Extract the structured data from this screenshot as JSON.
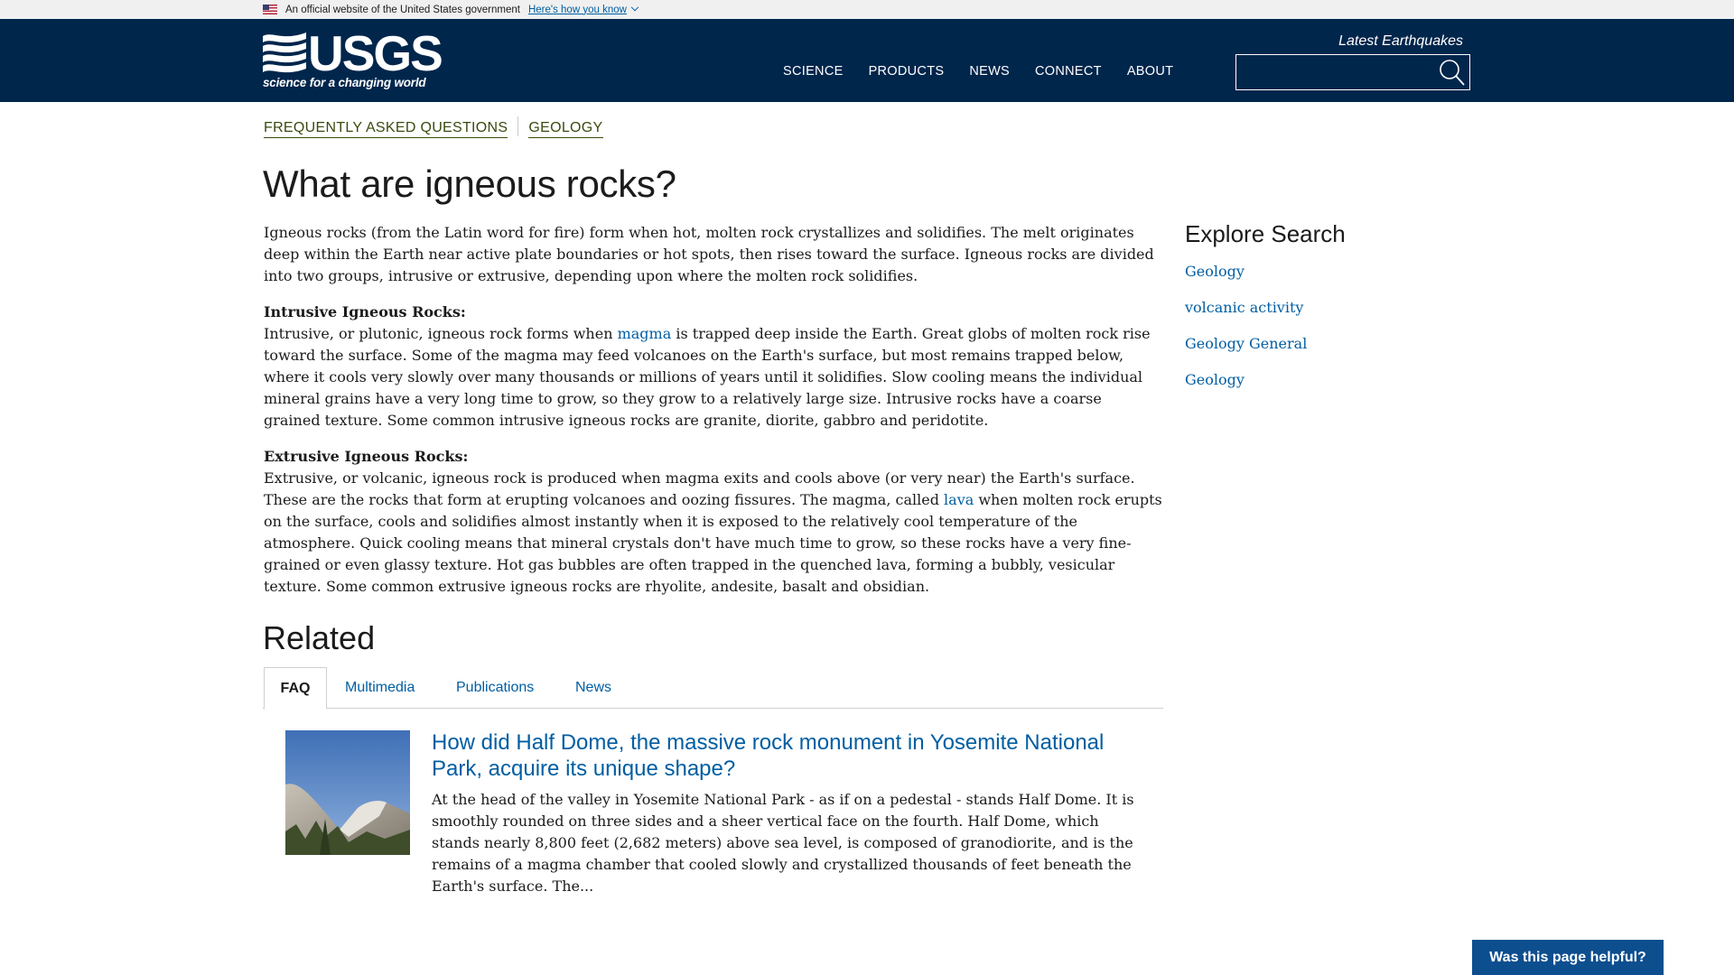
{
  "gov_banner": {
    "text": "An official website of the United States government",
    "link": "Here's how you know"
  },
  "header": {
    "logo_word": "USGS",
    "logo_tagline": "science for a changing world",
    "nav": [
      "SCIENCE",
      "PRODUCTS",
      "NEWS",
      "CONNECT",
      "ABOUT"
    ],
    "latest_earthquakes": "Latest Earthquakes",
    "search_value": ""
  },
  "breadcrumb": [
    "FREQUENTLY ASKED QUESTIONS",
    "GEOLOGY"
  ],
  "page_title": "What are igneous rocks?",
  "article": {
    "intro": "Igneous rocks (from the Latin word for fire) form when hot, molten rock crystallizes and solidifies. The melt originates deep within the Earth near active plate boundaries or hot spots, then rises toward the surface. Igneous rocks are divided into two groups, intrusive or extrusive, depending upon where the molten rock solidifies.",
    "intrusive_heading": "Intrusive Igneous Rocks:",
    "intrusive_pre": "Intrusive, or plutonic, igneous rock forms when ",
    "intrusive_link": "magma",
    "intrusive_post": " is trapped deep inside the Earth. Great globs of molten rock rise toward the surface. Some of the magma may feed volcanoes on the Earth's surface, but most remains trapped below, where it cools very slowly over many thousands or millions of years until it solidifies. Slow cooling means the individual mineral grains have a very long time to grow, so they grow to a relatively large size. Intrusive rocks have a coarse grained texture. Some common intrusive igneous rocks are granite, diorite, gabbro and peridotite.",
    "extrusive_heading": "Extrusive Igneous Rocks:",
    "extrusive_pre": "Extrusive, or volcanic, igneous rock is produced when magma exits and cools above (or very near) the Earth's surface. These are the rocks that form at erupting volcanoes and oozing fissures. The magma, called ",
    "extrusive_link": "lava",
    "extrusive_post": " when molten rock erupts on the surface, cools and solidifies almost instantly when it is exposed to the relatively cool temperature of the atmosphere. Quick cooling means that mineral crystals don't have much time to grow, so these rocks have a very fine-grained or even glassy texture. Hot gas bubbles are often trapped in the quenched lava, forming a bubbly, vesicular texture. Some common extrusive igneous rocks are rhyolite, andesite, basalt and obsidian."
  },
  "sidebar": {
    "title": "Explore Search",
    "links": [
      "Geology",
      "volcanic activity",
      "Geology General",
      "Geology"
    ]
  },
  "related": {
    "heading": "Related",
    "tabs": [
      "FAQ",
      "Multimedia",
      "Publications",
      "News"
    ],
    "active_tab": "FAQ",
    "card": {
      "title": "How did Half Dome, the massive rock monument in Yosemite National Park, acquire its unique shape?",
      "body": "At the head of the valley in Yosemite National Park - as if on a pedestal - stands Half Dome. It is smoothly rounded on three sides and a sheer vertical face on the fourth. Half Dome, which stands nearly 8,800 feet (2,682 meters) above sea level, is composed of granodiorite, and is the remains of a magma chamber that cooled slowly and crystallized thousands of feet beneath the Earth's surface. The..."
    }
  },
  "feedback_button": "Was this page helpful?",
  "colors": {
    "header_bg": "#00264c",
    "link": "#005ea2",
    "breadcrumb": "#394a0f",
    "feedback_bg": "#0d4e8f"
  }
}
